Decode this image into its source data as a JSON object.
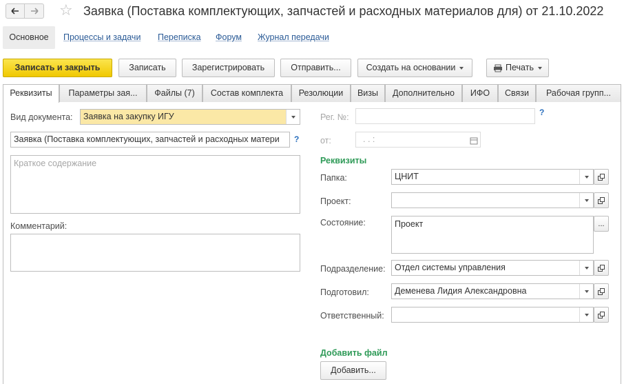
{
  "window": {
    "title": "Заявка (Поставка комплектующих, запчастей и расходных материалов для) от 21.10.2022"
  },
  "sections": {
    "active": "Основное",
    "links": [
      "Процессы и задачи",
      "Переписка",
      "Форум",
      "Журнал передачи"
    ]
  },
  "toolbar": {
    "save_close": "Записать и закрыть",
    "save": "Записать",
    "register": "Зарегистрировать",
    "send": "Отправить...",
    "create_based": "Создать на основании",
    "print": "Печать"
  },
  "tabs": [
    "Реквизиты",
    "Параметры зая...",
    "Файлы (7)",
    "Состав комплекта",
    "Резолюции",
    "Визы",
    "Дополнительно",
    "ИФО",
    "Связи",
    "Рабочая групп..."
  ],
  "form": {
    "doc_type_label": "Вид документа:",
    "doc_type_value": "Заявка на закупку ИГУ",
    "subject_value": "Заявка (Поставка комплектующих, запчастей и расходных матери",
    "summary_placeholder": "Краткое содержание",
    "comment_label": "Комментарий:",
    "comment_value": "",
    "reg_no_label": "Рег. №:",
    "reg_no_value": "",
    "date_label": "от:",
    "date_value": ". .   :",
    "help_mark": "?",
    "requisites_title": "Реквизиты",
    "folder_label": "Папка:",
    "folder_value": "ЦНИТ",
    "project_label": "Проект:",
    "project_value": "",
    "state_label": "Состояние:",
    "state_value": "Проект",
    "division_label": "Подразделение:",
    "division_value": "Отдел системы управления",
    "prepared_label": "Подготовил:",
    "prepared_value": "Деменева Лидия Александровна",
    "responsible_label": "Ответственный:",
    "responsible_value": "",
    "add_file_title": "Добавить файл",
    "add_button": "Добавить...",
    "ellipsis": "..."
  }
}
